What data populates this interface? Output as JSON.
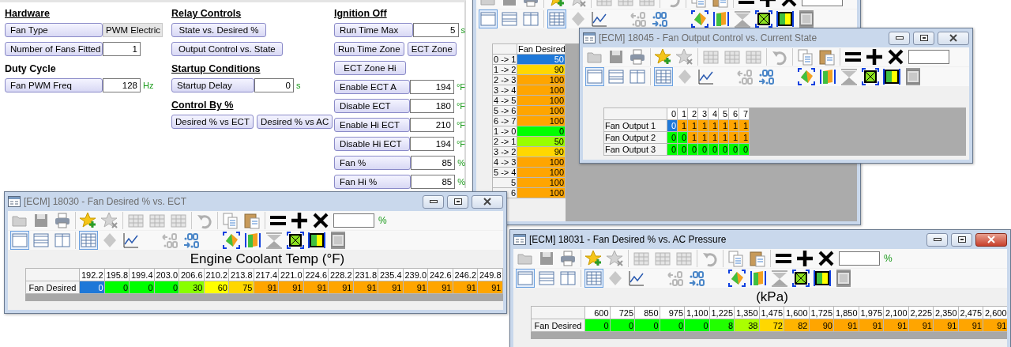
{
  "settings": {
    "columns": [
      {
        "sections": [
          {
            "heading": "Hardware",
            "underlined": true,
            "items": [
              {
                "kind": "dropdown",
                "label": "Fan Type",
                "value": "PWM Electric"
              },
              {
                "kind": "field",
                "label": "Number of Fans Fitted",
                "value": "1"
              }
            ]
          },
          {
            "heading": "Duty Cycle",
            "underlined": false,
            "items": [
              {
                "kind": "field",
                "label": "Fan PWM Freq",
                "value": "128",
                "unit": "Hz"
              }
            ]
          }
        ]
      },
      {
        "sections": [
          {
            "heading": "Relay Controls",
            "underlined": true,
            "items": [
              {
                "kind": "buttons",
                "labels": [
                  "State vs. Desired %"
                ]
              },
              {
                "kind": "buttons",
                "labels": [
                  "Output Control vs. State"
                ]
              }
            ]
          },
          {
            "heading": "Startup Conditions",
            "underlined": true,
            "items": [
              {
                "kind": "field",
                "label": "Startup Delay",
                "value": "0",
                "unit": "s"
              }
            ]
          },
          {
            "heading": "Control By %",
            "underlined": true,
            "items": [
              {
                "kind": "buttons",
                "labels": [
                  "Desired % vs ECT",
                  "Desired % vs AC"
                ]
              }
            ]
          }
        ]
      },
      {
        "sections": [
          {
            "heading": "Ignition Off",
            "underlined": true,
            "items": [
              {
                "kind": "field",
                "label": "Run Time Max",
                "value": "5",
                "unit": "s"
              },
              {
                "kind": "buttons",
                "labels": [
                  "Run Time Zone",
                  "ECT Zone"
                ]
              },
              {
                "kind": "buttons",
                "labels": [
                  "ECT Zone Hi"
                ]
              },
              {
                "kind": "field",
                "label": "Enable ECT A",
                "value": "194",
                "unit": "°F"
              },
              {
                "kind": "field",
                "label": "Disable ECT",
                "value": "180",
                "unit": "°F"
              },
              {
                "kind": "field",
                "label": "Enable Hi ECT",
                "value": "210",
                "unit": "°F"
              },
              {
                "kind": "field",
                "label": "Disable Hi ECT",
                "value": "194",
                "unit": "°F"
              },
              {
                "kind": "field",
                "label": "Fan %",
                "value": "85",
                "unit": "%"
              },
              {
                "kind": "field",
                "label": "Fan Hi %",
                "value": "85",
                "unit": "%"
              }
            ]
          }
        ]
      }
    ]
  },
  "windows": [
    {
      "kind": "column-table",
      "table": {
        "columns": [
          "Fan Desired"
        ],
        "rows": [
          {
            "label": "0 -> 1",
            "cells": [
              {
                "value": "50",
                "color": "#1e78d8"
              }
            ]
          },
          {
            "label": "1 -> 2",
            "cells": [
              {
                "value": "90",
                "color": "#ffd700"
              }
            ]
          },
          {
            "label": "2 -> 3",
            "cells": [
              {
                "value": "100",
                "color": "#ffa500"
              }
            ]
          },
          {
            "label": "3 -> 4",
            "cells": [
              {
                "value": "100",
                "color": "#ffa500"
              }
            ]
          },
          {
            "label": "4 -> 5",
            "cells": [
              {
                "value": "100",
                "color": "#ffa500"
              }
            ]
          },
          {
            "label": "5 -> 6",
            "cells": [
              {
                "value": "100",
                "color": "#ffa500"
              }
            ]
          },
          {
            "label": "6 -> 7",
            "cells": [
              {
                "value": "100",
                "color": "#ffa500"
              }
            ]
          },
          {
            "label": "1 -> 0",
            "cells": [
              {
                "value": "0",
                "color": "#00ff00"
              }
            ]
          },
          {
            "label": "2 -> 1",
            "cells": [
              {
                "value": "50",
                "color": "#99ff00"
              }
            ]
          },
          {
            "label": "3 -> 2",
            "cells": [
              {
                "value": "90",
                "color": "#ffd700"
              }
            ]
          },
          {
            "label": "4 -> 3",
            "cells": [
              {
                "value": "100",
                "color": "#ffa500"
              }
            ]
          },
          {
            "label": "5 -> 4",
            "cells": [
              {
                "value": "100",
                "color": "#ffa500"
              }
            ]
          },
          {
            "label": "5",
            "cells": [
              {
                "value": "100",
                "color": "#ffa500"
              }
            ]
          },
          {
            "label": "6",
            "cells": [
              {
                "value": "100",
                "color": "#ffa500"
              }
            ]
          }
        ]
      }
    },
    {
      "kind": "grid-table",
      "title": "[ECM] 18045 - Fan Output Control vs. Current State",
      "active": false,
      "table": {
        "columns": [
          "0",
          "1",
          "2",
          "3",
          "4",
          "5",
          "6",
          "7"
        ],
        "rows": [
          {
            "label": "Fan Output 1",
            "cells": [
              {
                "value": "0",
                "color": "#1e78d8"
              },
              {
                "value": "1",
                "color": "#ffa500"
              },
              {
                "value": "1",
                "color": "#ffa500"
              },
              {
                "value": "1",
                "color": "#ffa500"
              },
              {
                "value": "1",
                "color": "#ffa500"
              },
              {
                "value": "1",
                "color": "#ffa500"
              },
              {
                "value": "1",
                "color": "#ffa500"
              },
              {
                "value": "1",
                "color": "#ffa500"
              }
            ]
          },
          {
            "label": "Fan Output 2",
            "cells": [
              {
                "value": "0",
                "color": "#00ff00"
              },
              {
                "value": "0",
                "color": "#00ff00"
              },
              {
                "value": "1",
                "color": "#ffa500"
              },
              {
                "value": "1",
                "color": "#ffa500"
              },
              {
                "value": "1",
                "color": "#ffa500"
              },
              {
                "value": "1",
                "color": "#ffa500"
              },
              {
                "value": "1",
                "color": "#ffa500"
              },
              {
                "value": "1",
                "color": "#ffa500"
              }
            ]
          },
          {
            "label": "Fan Output 3",
            "cells": [
              {
                "value": "0",
                "color": "#00ff00"
              },
              {
                "value": "0",
                "color": "#00ff00"
              },
              {
                "value": "0",
                "color": "#00ff00"
              },
              {
                "value": "0",
                "color": "#00ff00"
              },
              {
                "value": "0",
                "color": "#00ff00"
              },
              {
                "value": "0",
                "color": "#00ff00"
              },
              {
                "value": "0",
                "color": "#00ff00"
              },
              {
                "value": "0",
                "color": "#00ff00"
              }
            ]
          }
        ]
      }
    },
    {
      "kind": "axis-table",
      "title": "[ECM] 18030 - Fan Desired % vs. ECT",
      "active": false,
      "unit": "%",
      "axis_title": "Engine Coolant Temp (°F)",
      "table": {
        "columns": [
          "192.2",
          "195.8",
          "199.4",
          "203.0",
          "206.6",
          "210.2",
          "213.8",
          "217.4",
          "221.0",
          "224.6",
          "228.2",
          "231.8",
          "235.4",
          "239.0",
          "242.6",
          "246.2",
          "249.8"
        ],
        "rows": [
          {
            "label": "Fan Desired",
            "cells": [
              {
                "value": "0",
                "color": "#1e78d8"
              },
              {
                "value": "0",
                "color": "#00ff00"
              },
              {
                "value": "0",
                "color": "#00ff00"
              },
              {
                "value": "0",
                "color": "#00ff00"
              },
              {
                "value": "30",
                "color": "#88ff00"
              },
              {
                "value": "60",
                "color": "#ffff00"
              },
              {
                "value": "75",
                "color": "#ffd700"
              },
              {
                "value": "91",
                "color": "#ffa500"
              },
              {
                "value": "91",
                "color": "#ffa500"
              },
              {
                "value": "91",
                "color": "#ffa500"
              },
              {
                "value": "91",
                "color": "#ffa500"
              },
              {
                "value": "91",
                "color": "#ffa500"
              },
              {
                "value": "91",
                "color": "#ffa500"
              },
              {
                "value": "91",
                "color": "#ffa500"
              },
              {
                "value": "91",
                "color": "#ffa500"
              },
              {
                "value": "91",
                "color": "#ffa500"
              },
              {
                "value": "91",
                "color": "#ffa500"
              }
            ]
          }
        ]
      }
    },
    {
      "kind": "axis-table",
      "title": "[ECM] 18031 - Fan Desired % vs. AC Pressure",
      "active": true,
      "unit": "%",
      "axis_title": "(kPa)",
      "table": {
        "columns": [
          "600",
          "725",
          "850",
          "975",
          "1,100",
          "1,225",
          "1,350",
          "1,475",
          "1,600",
          "1,725",
          "1,850",
          "1,975",
          "2,100",
          "2,225",
          "2,350",
          "2,475",
          "2,600"
        ],
        "rows": [
          {
            "label": "Fan Desired",
            "cells": [
              {
                "value": "0",
                "color": "#00ff00"
              },
              {
                "value": "0",
                "color": "#00ff00"
              },
              {
                "value": "0",
                "color": "#00ff00"
              },
              {
                "value": "0",
                "color": "#00ff00"
              },
              {
                "value": "0",
                "color": "#00ff00"
              },
              {
                "value": "8",
                "color": "#22ff00"
              },
              {
                "value": "38",
                "color": "#aaff00"
              },
              {
                "value": "72",
                "color": "#ffd700"
              },
              {
                "value": "82",
                "color": "#ffb400"
              },
              {
                "value": "90",
                "color": "#ffa500"
              },
              {
                "value": "91",
                "color": "#ffa500"
              },
              {
                "value": "91",
                "color": "#ffa500"
              },
              {
                "value": "91",
                "color": "#ffa500"
              },
              {
                "value": "91",
                "color": "#ffa500"
              },
              {
                "value": "91",
                "color": "#ffa500"
              },
              {
                "value": "91",
                "color": "#ffa500"
              },
              {
                "value": "91",
                "color": "#ffa500"
              }
            ]
          }
        ]
      }
    }
  ]
}
